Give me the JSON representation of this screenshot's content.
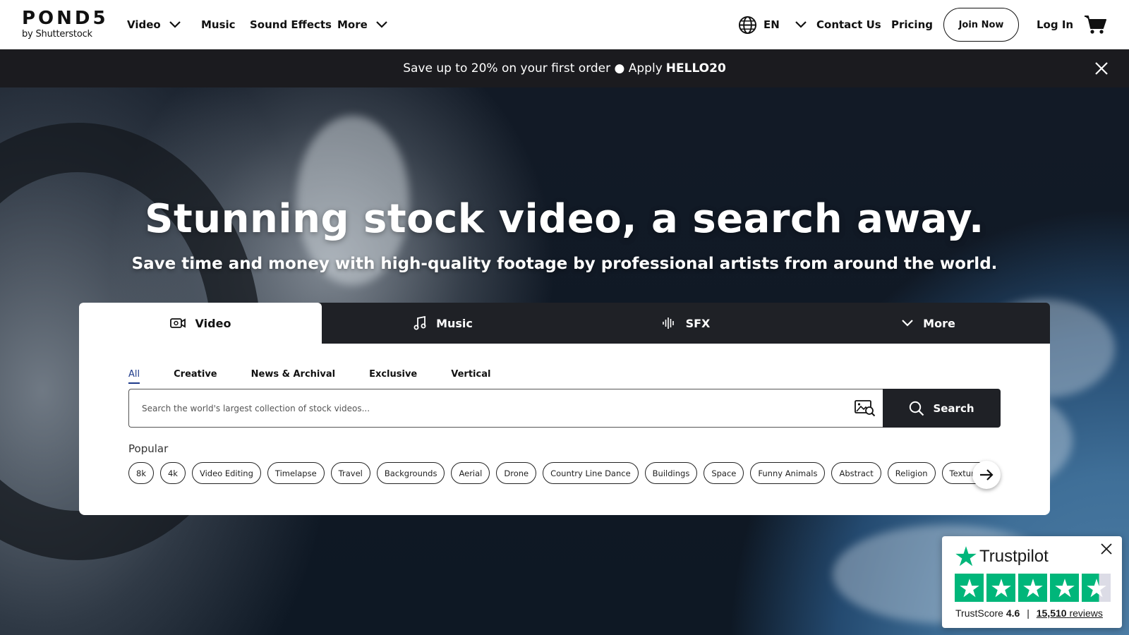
{
  "nav": {
    "logo_main": "POND5",
    "logo_sub": "by Shutterstock",
    "video": "Video",
    "music": "Music",
    "sound_effects": "Sound Effects",
    "more": "More",
    "language": "EN",
    "contact": "Contact Us",
    "pricing": "Pricing",
    "join": "Join Now",
    "login": "Log In"
  },
  "promo": {
    "text": "Save up to 20% on your first order ● Apply",
    "code": "HELLO20"
  },
  "hero": {
    "title": "Stunning stock video, a search away.",
    "subtitle": "Save time and money with high-quality footage by professional artists from around the world."
  },
  "media_tabs": [
    {
      "label": "Video",
      "icon": "video-camera-icon"
    },
    {
      "label": "Music",
      "icon": "music-note-icon"
    },
    {
      "label": "SFX",
      "icon": "sound-wave-icon"
    },
    {
      "label": "More",
      "icon": "chevron-down-icon"
    }
  ],
  "subtabs": [
    "All",
    "Creative",
    "News & Archival",
    "Exclusive",
    "Vertical"
  ],
  "search": {
    "placeholder": "Search the world's largest collection of stock videos...",
    "value": "",
    "button": "Search"
  },
  "popular": {
    "label": "Popular",
    "chips": [
      "8k",
      "4k",
      "Video Editing",
      "Timelapse",
      "Travel",
      "Backgrounds",
      "Aerial",
      "Drone",
      "Country Line Dance",
      "Buildings",
      "Space",
      "Funny Animals",
      "Abstract",
      "Religion",
      "Textures"
    ]
  },
  "trustpilot": {
    "brand": "Trustpilot",
    "score_label": "TrustScore",
    "score": "4.6",
    "separator": "|",
    "reviews_count": "15,510",
    "reviews_label": "reviews",
    "rating_stars": 4.6
  },
  "colors": {
    "accent_dark": "#1f2126",
    "promo_bg": "#1b1b1f",
    "trustpilot_green": "#00b67a",
    "active_link": "#1e3a8a"
  }
}
